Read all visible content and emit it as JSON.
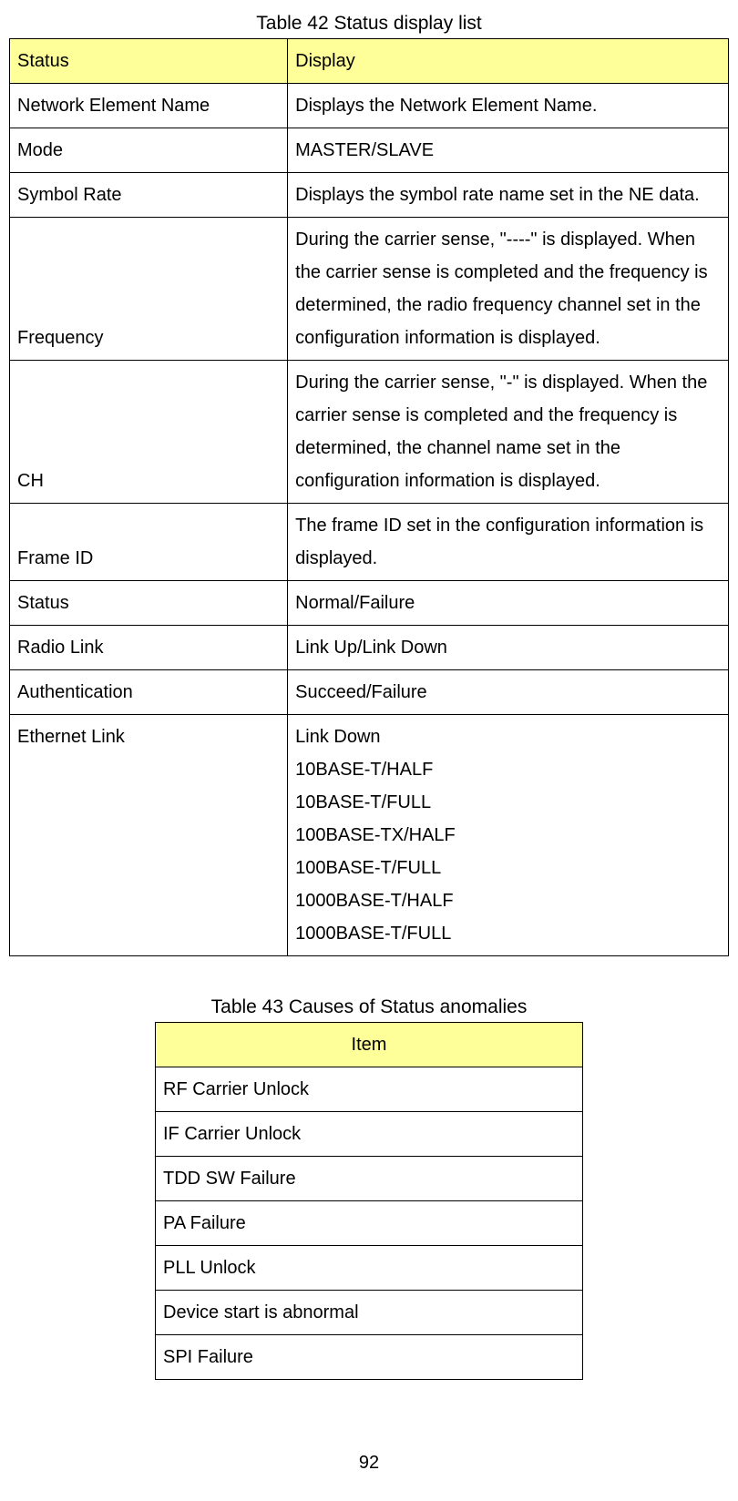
{
  "table42": {
    "title": "Table 42 Status display list",
    "headers": {
      "status": "Status",
      "display": "Display"
    },
    "rows": [
      {
        "status": "Network Element Name",
        "display": "Displays the Network Element Name."
      },
      {
        "status": "Mode",
        "display": "MASTER/SLAVE"
      },
      {
        "status": "Symbol Rate",
        "display": "Displays the symbol rate name set in the NE data."
      },
      {
        "status": "Frequency",
        "display": "During the carrier sense, \"----\" is displayed. When the carrier sense is completed and the frequency is determined, the radio frequency channel set in the configuration information is displayed."
      },
      {
        "status": "CH",
        "display": "During the carrier sense, \"-\" is displayed. When the carrier sense is completed and the frequency is determined, the channel name set in the configuration information is displayed."
      },
      {
        "status": "Frame ID",
        "display": "The frame ID set in the configuration information is displayed."
      },
      {
        "status": "Status",
        "display": "Normal/Failure"
      },
      {
        "status": "Radio Link",
        "display": "Link Up/Link Down"
      },
      {
        "status": "Authentication",
        "display": "Succeed/Failure"
      }
    ],
    "ethernet_row": {
      "status": "Ethernet Link",
      "lines": [
        "Link Down",
        "10BASE-T/HALF",
        "10BASE-T/FULL",
        "100BASE-TX/HALF",
        "100BASE-T/FULL",
        "1000BASE-T/HALF",
        "1000BASE-T/FULL"
      ]
    }
  },
  "table43": {
    "title": "Table 43 Causes of Status anomalies",
    "header": "Item",
    "items": [
      "RF Carrier Unlock",
      "IF Carrier Unlock",
      "TDD SW Failure",
      "PA Failure",
      "PLL Unlock",
      "Device start is abnormal",
      "SPI Failure"
    ]
  },
  "pageNumber": "92"
}
